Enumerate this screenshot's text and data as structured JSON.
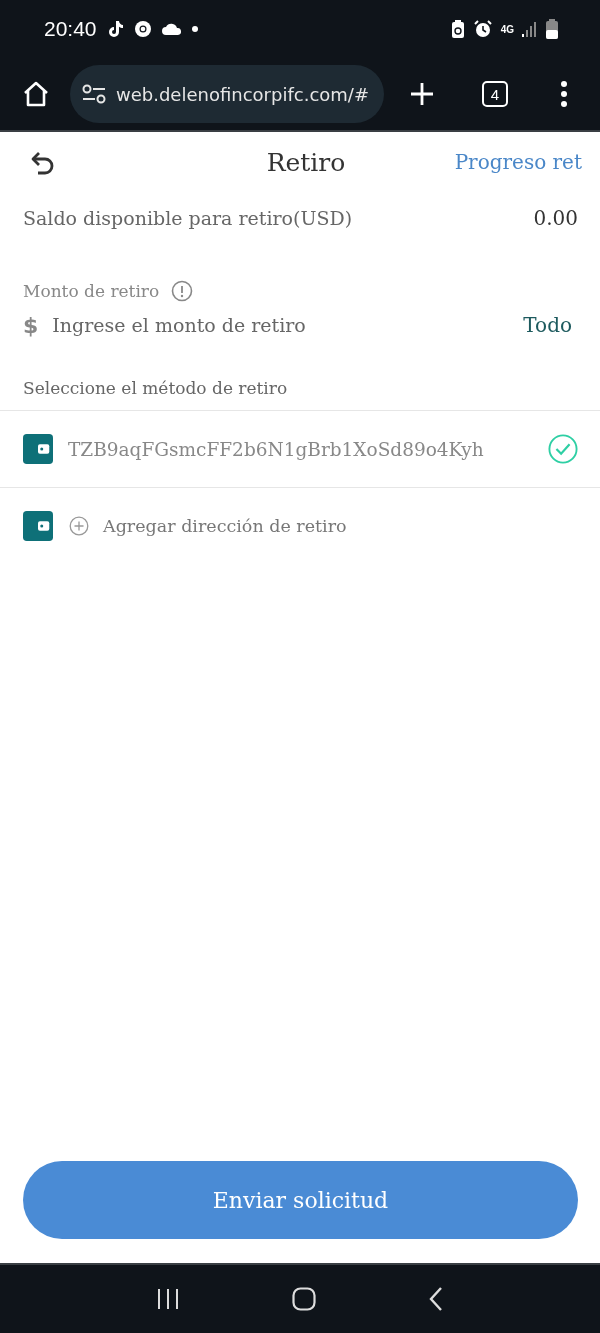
{
  "status_bar": {
    "time": "20:40",
    "network": "4G"
  },
  "browser": {
    "url": "web.delenofincorpifc.com/#",
    "tab_count": "4"
  },
  "header": {
    "title": "Retiro",
    "link": "Progreso ret"
  },
  "balance": {
    "label": "Saldo disponible para retiro(USD)",
    "value": "0.00"
  },
  "amount": {
    "label": "Monto de retiro",
    "currency": "$",
    "placeholder": "Ingrese el monto de retiro",
    "all_button": "Todo"
  },
  "methods_label": "Seleccione el método de retiro",
  "methods": [
    {
      "kind": "address",
      "text": "TZB9aqFGsmcFF2b6N1gBrb1XoSd89o4Kyh",
      "selected": true
    },
    {
      "kind": "add",
      "text": "Agregar dirección de retiro",
      "selected": false
    }
  ],
  "submit": "Enviar solicitud"
}
